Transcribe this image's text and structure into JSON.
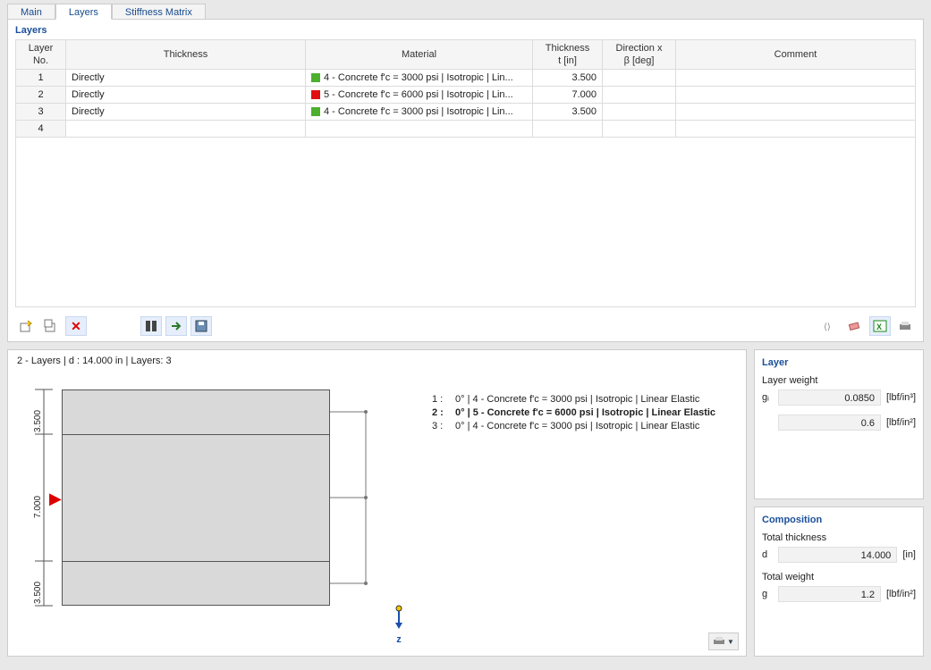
{
  "tabs": {
    "t0": "Main",
    "t1": "Layers",
    "t2": "Stiffness Matrix"
  },
  "section_title": "Layers",
  "columns": {
    "layer_no": "Layer\nNo.",
    "thickness_mode": "Thickness",
    "material": "Material",
    "thickness_t": "Thickness\nt [in]",
    "direction": "Direction x\nβ [deg]",
    "comment": "Comment"
  },
  "rows": [
    {
      "no": "1",
      "mode": "Directly",
      "mat_color": "#4caf2e",
      "mat": "4 - Concrete f'c = 3000 psi | Isotropic | Lin...",
      "t": "3.500",
      "beta": "",
      "comment": "",
      "editing": false
    },
    {
      "no": "2",
      "mode": "Directly",
      "mat_color": "#e01010",
      "mat": "5 - Concrete f'c = 6000 psi | Isotropic | Lin...",
      "t": "7.000",
      "beta": "",
      "comment": "",
      "editing": true
    },
    {
      "no": "3",
      "mode": "Directly",
      "mat_color": "#4caf2e",
      "mat": "4 - Concrete f'c = 3000 psi | Isotropic | Lin...",
      "t": "3.500",
      "beta": "",
      "comment": "",
      "editing": false
    },
    {
      "no": "4",
      "mode": "",
      "mat_color": "",
      "mat": "",
      "t": "",
      "beta": "",
      "comment": "",
      "editing": false
    }
  ],
  "preview_title": "2 - Layers | d : 14.000 in | Layers: 3",
  "dims": {
    "d1": "3.500",
    "d2": "7.000",
    "d3": "3.500"
  },
  "annotations": [
    {
      "idx": "1 :",
      "text": "0° | 4 - Concrete f'c = 3000 psi | Isotropic | Linear Elastic",
      "bold": false
    },
    {
      "idx": "2 :",
      "text": "0° | 5 - Concrete f'c = 6000 psi | Isotropic | Linear Elastic",
      "bold": true
    },
    {
      "idx": "3 :",
      "text": "0° | 4 - Concrete f'c = 3000 psi | Isotropic | Linear Elastic",
      "bold": false
    }
  ],
  "z_label": "z",
  "side_layer": {
    "title": "Layer",
    "weight_label": "Layer weight",
    "gi_sym": "gᵢ",
    "gi_val": "0.0850",
    "gi_unit": "[lbf/in³]",
    "g2_val": "0.6",
    "g2_unit": "[lbf/in²]"
  },
  "side_comp": {
    "title": "Composition",
    "tt_label": "Total thickness",
    "d_sym": "d",
    "d_val": "14.000",
    "d_unit": "[in]",
    "tw_label": "Total weight",
    "g_sym": "g",
    "g_val": "1.2",
    "g_unit": "[lbf/in²]"
  }
}
